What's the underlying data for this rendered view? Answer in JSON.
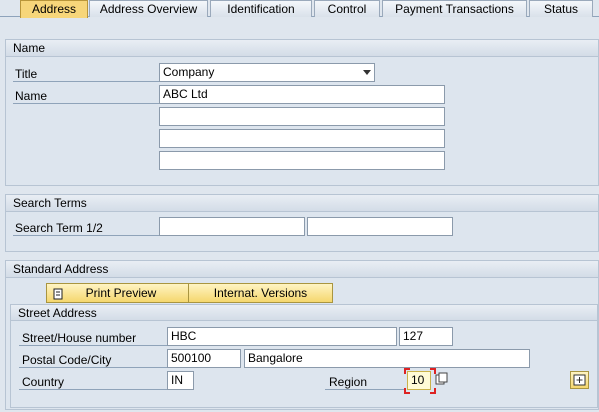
{
  "tabs": [
    {
      "label": "Address",
      "active": true
    },
    {
      "label": "Address Overview",
      "active": false
    },
    {
      "label": "Identification",
      "active": false
    },
    {
      "label": "Control",
      "active": false
    },
    {
      "label": "Payment Transactions",
      "active": false
    },
    {
      "label": "Status",
      "active": false
    }
  ],
  "name_group": {
    "title": "Name",
    "title_label": "Title",
    "title_value": "Company",
    "name_label": "Name",
    "name_values": [
      "ABC Ltd",
      "",
      "",
      ""
    ]
  },
  "search_group": {
    "title": "Search Terms",
    "label": "Search Term 1/2",
    "term1": "",
    "term2": ""
  },
  "address_group": {
    "title": "Standard Address",
    "print_preview_label": "Print Preview",
    "internat_label": "Internat. Versions",
    "street_box_title": "Street Address",
    "street_label": "Street/House number",
    "street_value": "HBC",
    "house_number": "127",
    "postal_label": "Postal Code/City",
    "postal_value": "500100",
    "city_value": "Bangalore",
    "country_label": "Country",
    "country_value": "IN",
    "region_label": "Region",
    "region_value": "10"
  },
  "colors": {
    "active_tab": "#f7d67a",
    "button": "#f5d76e",
    "focus": "#dd2222"
  },
  "icons": [
    "print-icon",
    "dropdown-arrow-icon",
    "value-help-icon",
    "more-fields-icon"
  ]
}
